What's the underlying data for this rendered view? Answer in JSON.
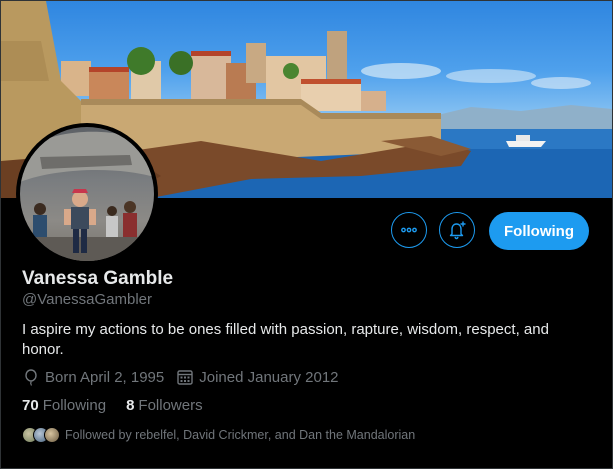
{
  "profile": {
    "display_name": "Vanessa Gamble",
    "handle": "@VanessaGambler",
    "bio": "I aspire my actions to be ones filled with passion, rapture, wisdom, respect, and honor.",
    "born": "Born April 2, 1995",
    "joined": "Joined January 2012"
  },
  "actions": {
    "following_label": "Following",
    "more_icon": "more-horizontal-icon",
    "notify_icon": "bell-plus-icon"
  },
  "stats": {
    "following_count": "70",
    "following_label": "Following",
    "followers_count": "8",
    "followers_label": "Followers"
  },
  "followed_by": {
    "text": "Followed by rebelfel, David Crickmer, and Dan the Mandalorian"
  },
  "colors": {
    "accent": "#1d9bf0",
    "background": "#000000",
    "secondary_text": "#71767b"
  }
}
